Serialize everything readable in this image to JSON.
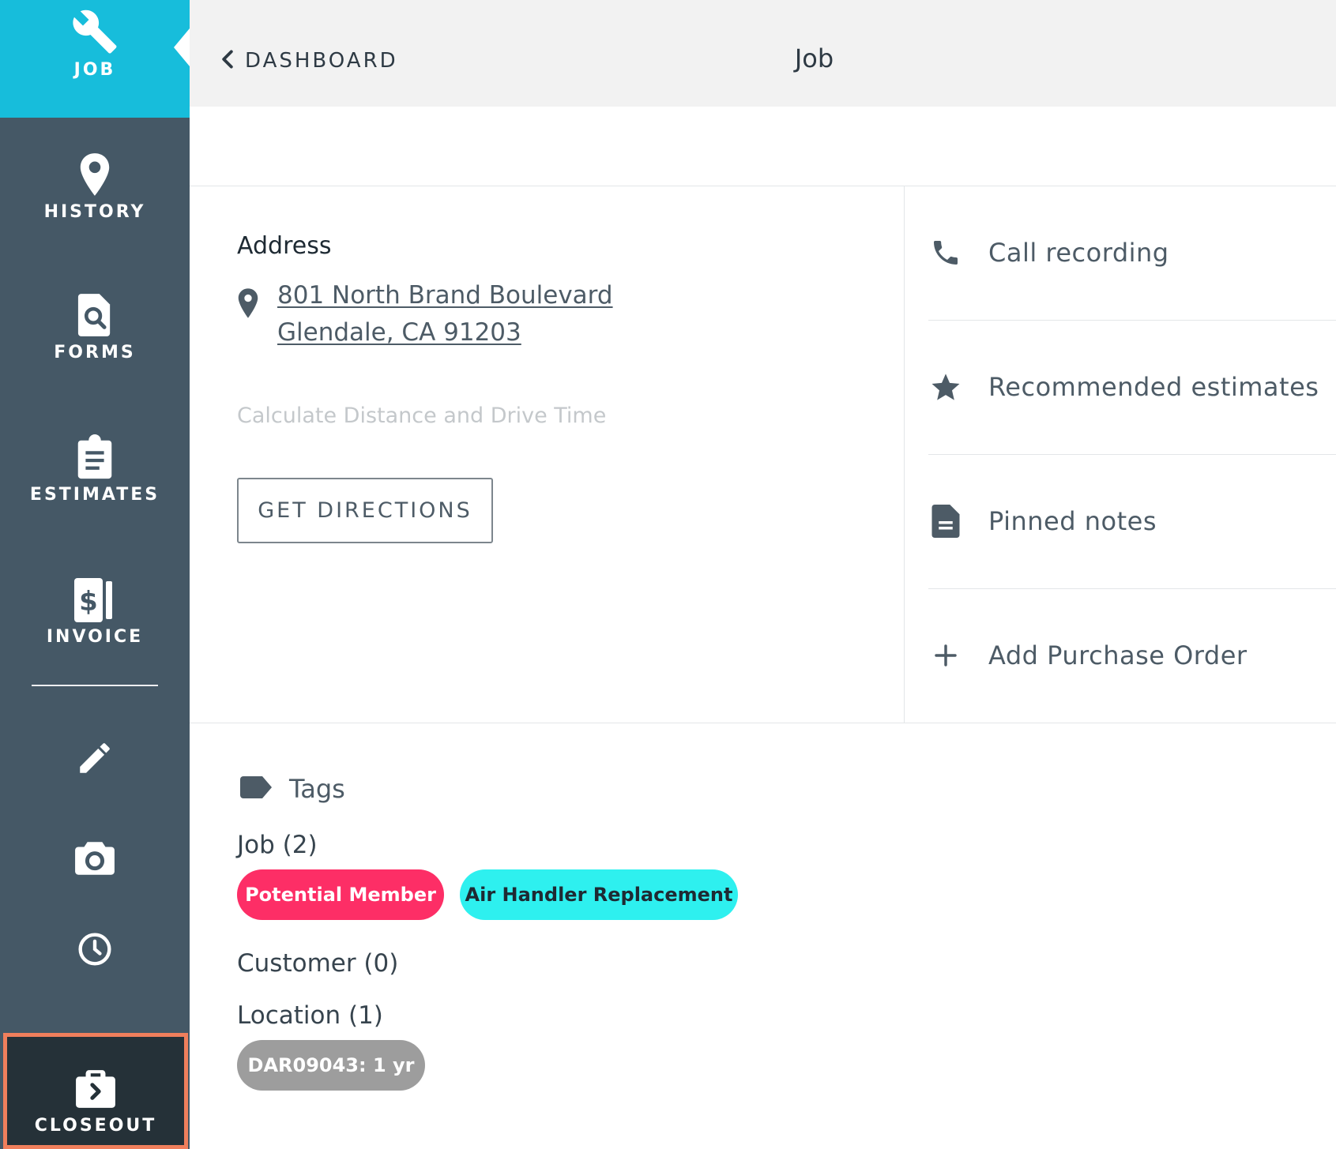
{
  "sidebar": {
    "active_color": "#17bddb",
    "background_color": "#455866",
    "items": [
      {
        "label": "JOB",
        "icon": "wrench-icon"
      },
      {
        "label": "HISTORY",
        "icon": "map-pin-icon"
      },
      {
        "label": "FORMS",
        "icon": "document-search-icon"
      },
      {
        "label": "ESTIMATES",
        "icon": "clipboard-icon"
      },
      {
        "label": "INVOICE",
        "icon": "invoice-dollar-icon"
      }
    ],
    "tools": [
      {
        "icon": "pencil-icon"
      },
      {
        "icon": "camera-icon"
      },
      {
        "icon": "clock-icon"
      }
    ],
    "closeout": {
      "label": "CLOSEOUT",
      "icon": "briefcase-arrow-icon",
      "highlight_color": "#f07f5c"
    }
  },
  "header": {
    "back_label": "DASHBOARD",
    "title": "Job"
  },
  "address": {
    "heading": "Address",
    "line1": "801 North Brand Boulevard",
    "line2": "Glendale, CA 91203",
    "calc_link": "Calculate Distance and Drive Time",
    "directions_button": "GET DIRECTIONS"
  },
  "side_panel": {
    "items": [
      {
        "label": "Call recording",
        "icon": "phone-icon"
      },
      {
        "label": "Recommended estimates",
        "icon": "star-icon"
      },
      {
        "label": "Pinned notes",
        "icon": "note-icon"
      },
      {
        "label": "Add Purchase Order",
        "icon": "plus-icon"
      }
    ]
  },
  "tags": {
    "heading": "Tags",
    "job_title": "Job (2)",
    "job_tags": [
      {
        "label": "Potential Member",
        "color": "#fd2e66",
        "text_color": "#ffffff"
      },
      {
        "label": "Air Handler Replacement",
        "color": "#2ef0ef",
        "text_color": "#1e2a33"
      }
    ],
    "customer_title": "Customer (0)",
    "location_title": "Location (1)",
    "location_tags": [
      {
        "label": "DAR09043: 1 yr",
        "color": "#9d9d9d",
        "text_color": "#ffffff"
      }
    ]
  }
}
